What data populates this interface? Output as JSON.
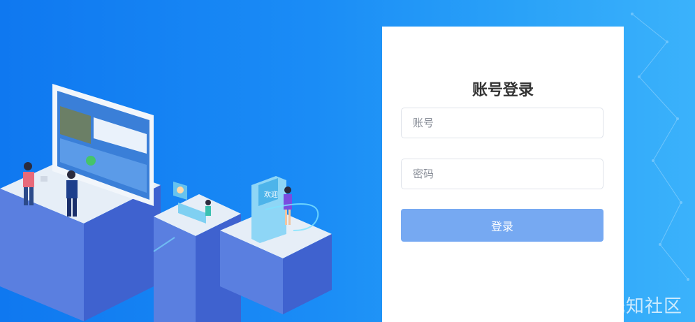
{
  "login": {
    "title": "账号登录",
    "username_placeholder": "账号",
    "password_placeholder": "密码",
    "submit_label": "登录"
  },
  "illustration": {
    "kiosk_sign": "欢迎"
  },
  "watermark": {
    "text": "先知社区",
    "icon": "xianzhi-logo-icon"
  },
  "colors": {
    "background_start": "#0f78f0",
    "background_end": "#3bb2fb",
    "button": "#76a9f2",
    "card": "#ffffff"
  }
}
